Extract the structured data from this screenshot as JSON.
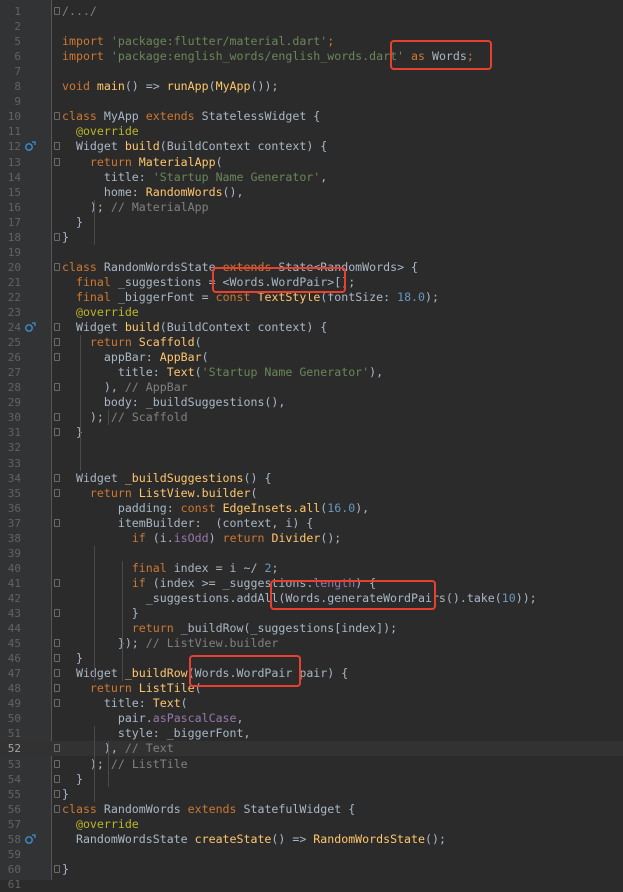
{
  "editor": {
    "language": "dart",
    "current_line": "52",
    "lines": [
      {
        "n": "1",
        "t": [
          [
            "cm",
            "/.../"
          ]
        ]
      },
      {
        "n": "2",
        "t": []
      },
      {
        "n": "5",
        "t": [
          [
            "kw",
            "import "
          ],
          [
            "str",
            "'package:flutter/material.dart'"
          ],
          [
            "kw",
            ";"
          ]
        ]
      },
      {
        "n": "6",
        "t": [
          [
            "kw",
            "import "
          ],
          [
            "str",
            "'package:english_words/english_words.dart'"
          ],
          [
            "kw",
            " as "
          ],
          [
            "p",
            "Words"
          ],
          [
            "kw",
            ";"
          ]
        ]
      },
      {
        "n": "7",
        "t": []
      },
      {
        "n": "8",
        "t": [
          [
            "kw",
            "void "
          ],
          [
            "fn",
            "main"
          ],
          [
            "p",
            "() => "
          ],
          [
            "fn",
            "runApp"
          ],
          [
            "p",
            "("
          ],
          [
            "fn",
            "MyApp"
          ],
          [
            "p",
            "());"
          ]
        ]
      },
      {
        "n": "9",
        "t": []
      },
      {
        "n": "10",
        "t": [
          [
            "kw",
            "class "
          ],
          [
            "p",
            "MyApp "
          ],
          [
            "kw",
            "extends "
          ],
          [
            "p",
            "StatelessWidget {"
          ]
        ]
      },
      {
        "n": "11",
        "t": [
          [
            "p",
            "  "
          ],
          [
            "an",
            "@override"
          ]
        ]
      },
      {
        "n": "12",
        "t": [
          [
            "p",
            "  Widget "
          ],
          [
            "fn",
            "build"
          ],
          [
            "p",
            "(BuildContext context) {"
          ]
        ]
      },
      {
        "n": "13",
        "t": [
          [
            "p",
            "    "
          ],
          [
            "kw",
            "return "
          ],
          [
            "fn",
            "MaterialApp"
          ],
          [
            "p",
            "("
          ]
        ]
      },
      {
        "n": "14",
        "t": [
          [
            "p",
            "      title: "
          ],
          [
            "str",
            "'Startup Name Generator'"
          ],
          [
            "p",
            ","
          ]
        ]
      },
      {
        "n": "15",
        "t": [
          [
            "p",
            "      home: "
          ],
          [
            "fn",
            "RandomWords"
          ],
          [
            "p",
            "(),"
          ]
        ]
      },
      {
        "n": "16",
        "t": [
          [
            "p",
            "    ); "
          ],
          [
            "cm",
            "// MaterialApp"
          ]
        ]
      },
      {
        "n": "17",
        "t": [
          [
            "p",
            "  }"
          ]
        ]
      },
      {
        "n": "18",
        "t": [
          [
            "p",
            "}"
          ]
        ]
      },
      {
        "n": "19",
        "t": []
      },
      {
        "n": "20",
        "t": [
          [
            "kw",
            "class "
          ],
          [
            "p",
            "RandomWordsState "
          ],
          [
            "kw",
            "extends "
          ],
          [
            "p",
            "State<RandomWords> {"
          ]
        ]
      },
      {
        "n": "21",
        "t": [
          [
            "p",
            "  "
          ],
          [
            "kw",
            "final "
          ],
          [
            "p",
            "_suggestions = <Words.WordPair>[];"
          ]
        ]
      },
      {
        "n": "22",
        "t": [
          [
            "p",
            "  "
          ],
          [
            "kw",
            "final "
          ],
          [
            "p",
            "_biggerFont = "
          ],
          [
            "kw",
            "const "
          ],
          [
            "fn",
            "TextStyle"
          ],
          [
            "p",
            "(fontSize: "
          ],
          [
            "num",
            "18.0"
          ],
          [
            "p",
            ");"
          ]
        ]
      },
      {
        "n": "23",
        "t": [
          [
            "p",
            "  "
          ],
          [
            "an",
            "@override"
          ]
        ]
      },
      {
        "n": "24",
        "t": [
          [
            "p",
            "  Widget "
          ],
          [
            "fn",
            "build"
          ],
          [
            "p",
            "(BuildContext context) {"
          ]
        ]
      },
      {
        "n": "25",
        "t": [
          [
            "p",
            "    "
          ],
          [
            "kw",
            "return "
          ],
          [
            "fn",
            "Scaffold"
          ],
          [
            "p",
            "("
          ]
        ]
      },
      {
        "n": "26",
        "t": [
          [
            "p",
            "      appBar: "
          ],
          [
            "fn",
            "AppBar"
          ],
          [
            "p",
            "("
          ]
        ]
      },
      {
        "n": "27",
        "t": [
          [
            "p",
            "        title: "
          ],
          [
            "fn",
            "Text"
          ],
          [
            "p",
            "("
          ],
          [
            "str",
            "'Startup Name Generator'"
          ],
          [
            "p",
            "),"
          ]
        ]
      },
      {
        "n": "28",
        "t": [
          [
            "p",
            "      ), "
          ],
          [
            "cm",
            "// AppBar"
          ]
        ]
      },
      {
        "n": "29",
        "t": [
          [
            "p",
            "      body: _buildSuggestions(),"
          ]
        ]
      },
      {
        "n": "30",
        "t": [
          [
            "p",
            "    ); "
          ],
          [
            "cm",
            "// Scaffold"
          ]
        ]
      },
      {
        "n": "31",
        "t": [
          [
            "p",
            "  }"
          ]
        ]
      },
      {
        "n": "32",
        "t": []
      },
      {
        "n": "33",
        "t": []
      },
      {
        "n": "34",
        "t": [
          [
            "p",
            "  Widget "
          ],
          [
            "fn",
            "_buildSuggestions"
          ],
          [
            "p",
            "() {"
          ]
        ]
      },
      {
        "n": "35",
        "t": [
          [
            "p",
            "    "
          ],
          [
            "kw",
            "return "
          ],
          [
            "fn",
            "ListView.builder"
          ],
          [
            "p",
            "("
          ]
        ]
      },
      {
        "n": "36",
        "t": [
          [
            "p",
            "        padding: "
          ],
          [
            "kw",
            "const "
          ],
          [
            "fn",
            "EdgeInsets.all"
          ],
          [
            "p",
            "("
          ],
          [
            "num",
            "16.0"
          ],
          [
            "p",
            "),"
          ]
        ]
      },
      {
        "n": "37",
        "t": [
          [
            "p",
            "        itemBuilder:  (context, i) {"
          ]
        ]
      },
      {
        "n": "38",
        "t": [
          [
            "p",
            "          "
          ],
          [
            "kw",
            "if "
          ],
          [
            "p",
            "(i."
          ],
          [
            "fld",
            "isOdd"
          ],
          [
            "p",
            ") "
          ],
          [
            "kw",
            "return "
          ],
          [
            "fn",
            "Divider"
          ],
          [
            "p",
            "();"
          ]
        ]
      },
      {
        "n": "39",
        "t": []
      },
      {
        "n": "40",
        "t": [
          [
            "p",
            "          "
          ],
          [
            "kw",
            "final "
          ],
          [
            "p",
            "index = i ~/ "
          ],
          [
            "num",
            "2"
          ],
          [
            "p",
            ";"
          ]
        ]
      },
      {
        "n": "41",
        "t": [
          [
            "p",
            "          "
          ],
          [
            "kw",
            "if "
          ],
          [
            "p",
            "(index >= _suggestions."
          ],
          [
            "fld",
            "length"
          ],
          [
            "p",
            ") {"
          ]
        ]
      },
      {
        "n": "42",
        "t": [
          [
            "p",
            "            _suggestions.addAll(Words.generateWordPairs().take("
          ],
          [
            "num",
            "10"
          ],
          [
            "p",
            "));"
          ]
        ]
      },
      {
        "n": "43",
        "t": [
          [
            "p",
            "          }"
          ]
        ]
      },
      {
        "n": "44",
        "t": [
          [
            "p",
            "          "
          ],
          [
            "kw",
            "return "
          ],
          [
            "p",
            "_buildRow(_suggestions[index]);"
          ]
        ]
      },
      {
        "n": "45",
        "t": [
          [
            "p",
            "        }); "
          ],
          [
            "cm",
            "// ListView.builder"
          ]
        ]
      },
      {
        "n": "46",
        "t": [
          [
            "p",
            "  }"
          ]
        ]
      },
      {
        "n": "47",
        "t": [
          [
            "p",
            "  Widget "
          ],
          [
            "fn",
            "_buildRow"
          ],
          [
            "p",
            "(Words.WordPair pair) {"
          ]
        ]
      },
      {
        "n": "48",
        "t": [
          [
            "p",
            "    "
          ],
          [
            "kw",
            "return "
          ],
          [
            "fn",
            "ListTile"
          ],
          [
            "p",
            "("
          ]
        ]
      },
      {
        "n": "49",
        "t": [
          [
            "p",
            "      title: "
          ],
          [
            "fn",
            "Text"
          ],
          [
            "p",
            "("
          ]
        ]
      },
      {
        "n": "50",
        "t": [
          [
            "p",
            "        pair."
          ],
          [
            "fld",
            "asPascalCase"
          ],
          [
            "p",
            ","
          ]
        ]
      },
      {
        "n": "51",
        "t": [
          [
            "p",
            "        style: _biggerFont,"
          ]
        ]
      },
      {
        "n": "52",
        "t": [
          [
            "p",
            "      ), "
          ],
          [
            "cm",
            "// Text"
          ]
        ]
      },
      {
        "n": "53",
        "t": [
          [
            "p",
            "    ); "
          ],
          [
            "cm",
            "// ListTile"
          ]
        ]
      },
      {
        "n": "54",
        "t": [
          [
            "p",
            "  }"
          ]
        ]
      },
      {
        "n": "55",
        "t": [
          [
            "p",
            "}"
          ]
        ]
      },
      {
        "n": "56",
        "t": [
          [
            "kw",
            "class "
          ],
          [
            "p",
            "RandomWords "
          ],
          [
            "kw",
            "extends "
          ],
          [
            "p",
            "StatefulWidget {"
          ]
        ]
      },
      {
        "n": "57",
        "t": [
          [
            "p",
            "  "
          ],
          [
            "an",
            "@override"
          ]
        ]
      },
      {
        "n": "58",
        "t": [
          [
            "p",
            "  RandomWordsState "
          ],
          [
            "fn",
            "createState"
          ],
          [
            "p",
            "() => "
          ],
          [
            "fn",
            "RandomWordsState"
          ],
          [
            "p",
            "();"
          ]
        ]
      },
      {
        "n": "59",
        "t": []
      },
      {
        "n": "60",
        "t": [
          [
            "p",
            "}"
          ]
        ]
      },
      {
        "n": "61",
        "t": []
      }
    ]
  },
  "colors": {
    "background": "#2b2b2b",
    "gutter": "#313335",
    "highlight_box": "#e8402f",
    "override_marker": "#3d8fd1"
  }
}
